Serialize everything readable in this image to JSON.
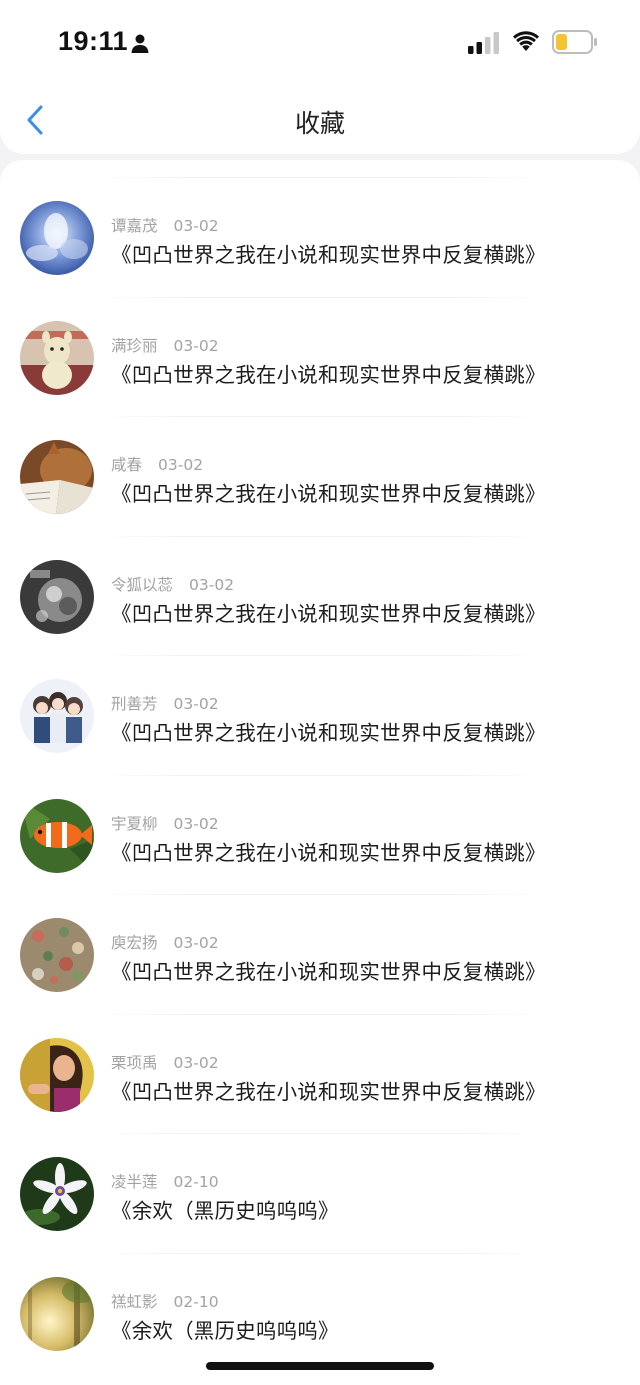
{
  "status_bar": {
    "time": "19:11",
    "icons": [
      "person-icon",
      "signal-icon",
      "wifi-icon",
      "battery-icon"
    ],
    "battery_color": "#f4c430"
  },
  "nav": {
    "back_icon": "chevron-left-icon",
    "title": "收藏",
    "accent_color": "#3a8ee6"
  },
  "favorites": [
    {
      "author": "谭嘉茂",
      "date": "03-02",
      "title": "《凹凸世界之我在小说和现实世界中反复横跳》",
      "avatar": "clouds-avatar"
    },
    {
      "author": "满珍丽",
      "date": "03-02",
      "title": "《凹凸世界之我在小说和现实世界中反复横跳》",
      "avatar": "plush-toy-avatar"
    },
    {
      "author": "咸春",
      "date": "03-02",
      "title": "《凹凸世界之我在小说和现实世界中反复横跳》",
      "avatar": "cat-book-avatar"
    },
    {
      "author": "令狐以蕊",
      "date": "03-02",
      "title": "《凹凸世界之我在小说和现实世界中反复横跳》",
      "avatar": "grayscale-avatar"
    },
    {
      "author": "刑善芳",
      "date": "03-02",
      "title": "《凹凸世界之我在小说和现实世界中反复横跳》",
      "avatar": "anime-group-avatar"
    },
    {
      "author": "宇夏柳",
      "date": "03-02",
      "title": "《凹凸世界之我在小说和现实世界中反复横跳》",
      "avatar": "clownfish-avatar"
    },
    {
      "author": "庾宏扬",
      "date": "03-02",
      "title": "《凹凸世界之我在小说和现实世界中反复横跳》",
      "avatar": "wall-decor-avatar"
    },
    {
      "author": "栗项禹",
      "date": "03-02",
      "title": "《凹凸世界之我在小说和现实世界中反复横跳》",
      "avatar": "woman-portrait-avatar"
    },
    {
      "author": "凌半莲",
      "date": "02-10",
      "title": "《余欢（黑历史呜呜呜》",
      "avatar": "white-flower-avatar"
    },
    {
      "author": "禚虹影",
      "date": "02-10",
      "title": "《余欢（黑历史呜呜呜》",
      "avatar": "forest-light-avatar"
    }
  ]
}
